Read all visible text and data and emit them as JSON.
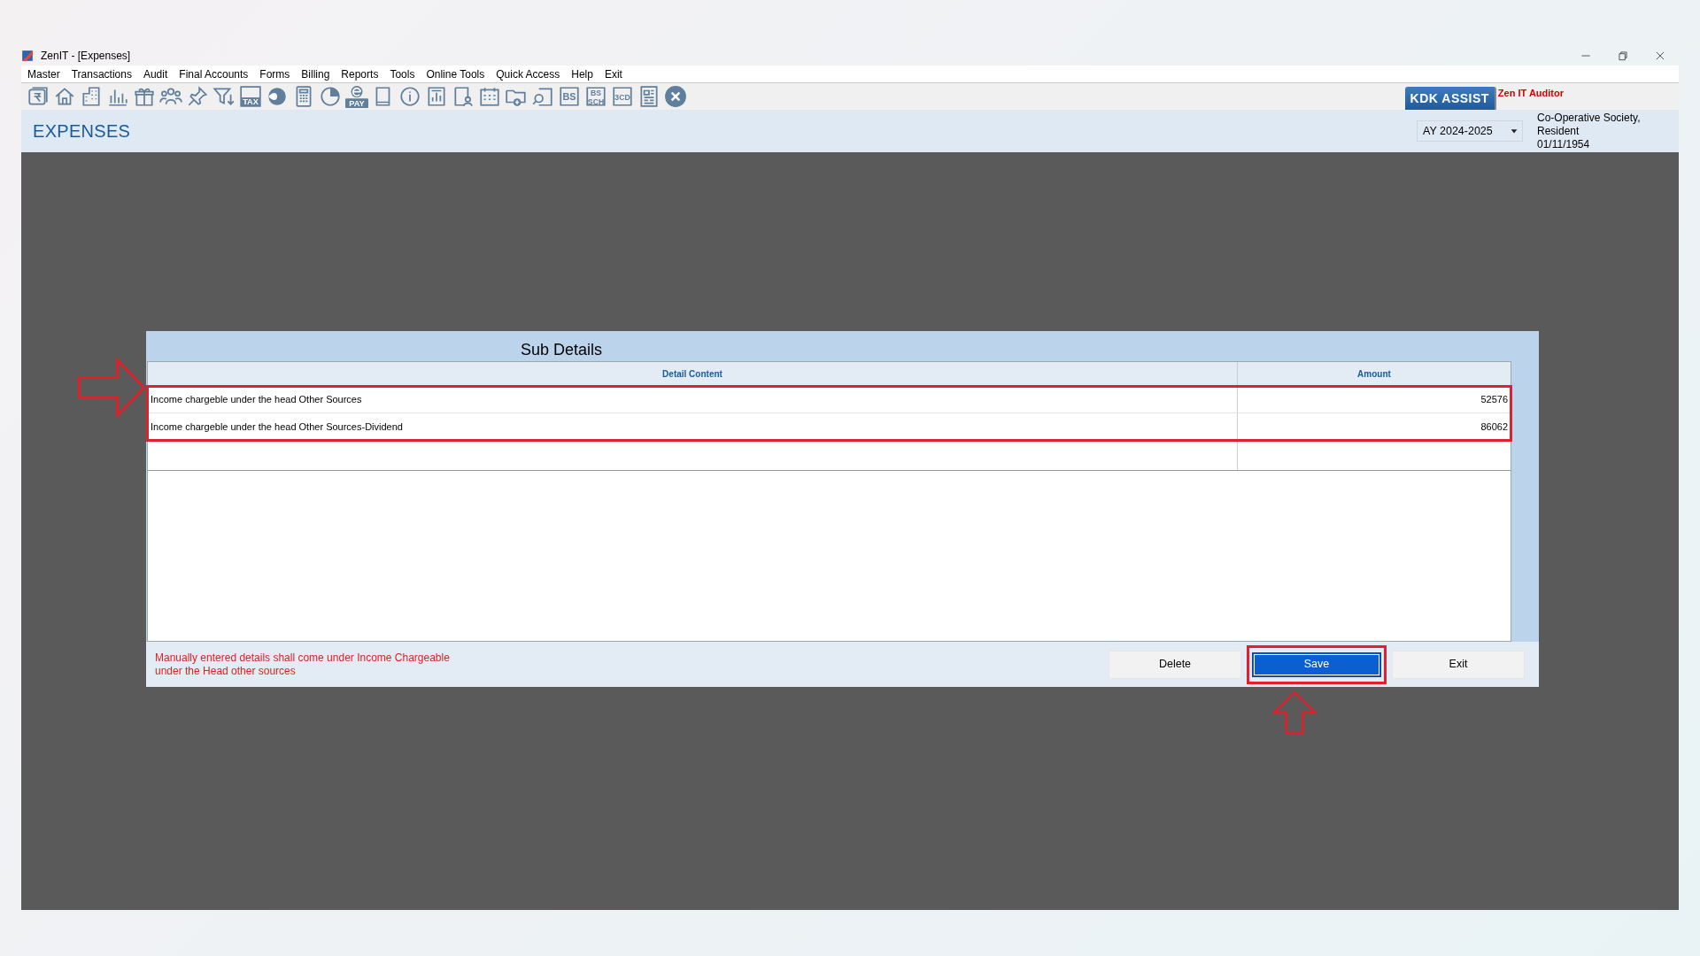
{
  "window": {
    "title": "ZenIT - [Expenses]"
  },
  "menu": [
    "Master",
    "Transactions",
    "Audit",
    "Final Accounts",
    "Forms",
    "Billing",
    "Reports",
    "Tools",
    "Online Tools",
    "Quick Access",
    "Help",
    "Exit"
  ],
  "toolbar": [
    {
      "kind": "rupee"
    },
    {
      "kind": "home"
    },
    {
      "kind": "building"
    },
    {
      "kind": "barchart"
    },
    {
      "kind": "gift"
    },
    {
      "kind": "people"
    },
    {
      "kind": "pin"
    },
    {
      "kind": "filter"
    },
    {
      "kind": "tagged",
      "label": "TAX"
    },
    {
      "kind": "disc"
    },
    {
      "kind": "calculator"
    },
    {
      "kind": "pie"
    },
    {
      "kind": "epay",
      "label": "PAY"
    },
    {
      "kind": "book"
    },
    {
      "kind": "info"
    },
    {
      "kind": "report"
    },
    {
      "kind": "userdoc"
    },
    {
      "kind": "calendar"
    },
    {
      "kind": "folderadd"
    },
    {
      "kind": "docsearch"
    },
    {
      "kind": "boxed",
      "label": "BS"
    },
    {
      "kind": "boxed2",
      "label": "BS",
      "sublabel": "SCH"
    },
    {
      "kind": "boxed",
      "label": "3CD"
    },
    {
      "kind": "griddoc"
    },
    {
      "kind": "closecircle"
    }
  ],
  "assist_button": "KDK ASSIST",
  "product_label": "Zen IT Auditor",
  "header": {
    "title": "EXPENSES",
    "year_select": "AY 2024-2025",
    "client_lines": [
      "Co-Operative Society,",
      "Resident",
      "01/11/1954"
    ]
  },
  "dialog": {
    "title": "Sub Details",
    "columns": [
      "Detail Content",
      "Amount"
    ],
    "rows": [
      {
        "detail": "Income chargeble under the head Other Sources",
        "amount": "52576"
      },
      {
        "detail": "Income chargeble under the head Other Sources-Dividend",
        "amount": "86062"
      }
    ],
    "note_lines": [
      "Manually entered details shall come under Income Chargeable",
      "under the Head other sources"
    ],
    "buttons": [
      {
        "label": "Delete",
        "primary": false
      },
      {
        "label": "Save",
        "primary": true
      },
      {
        "label": "Exit",
        "primary": false
      }
    ]
  },
  "annotations": {
    "rows_frame": true,
    "save_frame": true,
    "left_arrow": true,
    "up_arrow": true
  }
}
